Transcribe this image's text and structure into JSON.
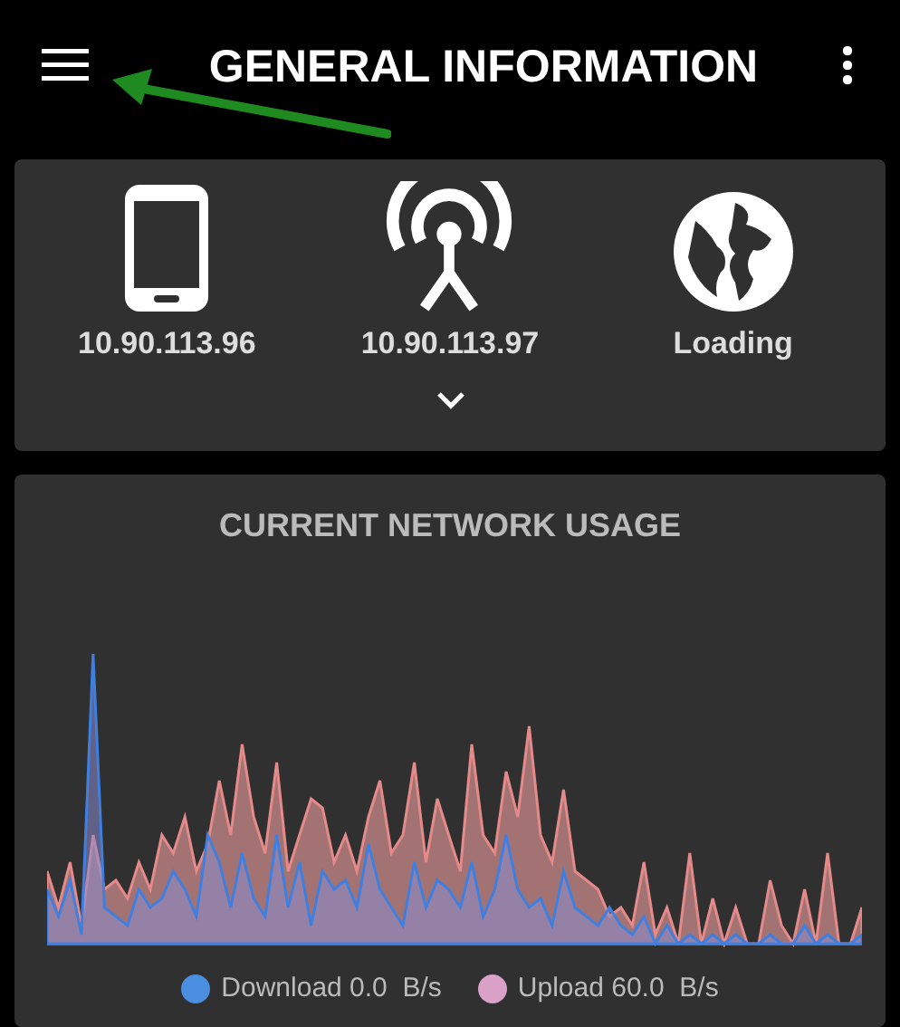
{
  "header": {
    "title": "GENERAL INFORMATION"
  },
  "devices": [
    {
      "kind": "phone",
      "label": "10.90.113.96"
    },
    {
      "kind": "antenna",
      "label": "10.90.113.97"
    },
    {
      "kind": "globe",
      "label": "Loading"
    }
  ],
  "usage": {
    "title": "CURRENT NETWORK USAGE",
    "legend": [
      {
        "label": "Download 0.0  B/s",
        "color": "#4a8fe0"
      },
      {
        "label": "Upload 60.0  B/s",
        "color": "#d9a0c8"
      }
    ]
  }
}
